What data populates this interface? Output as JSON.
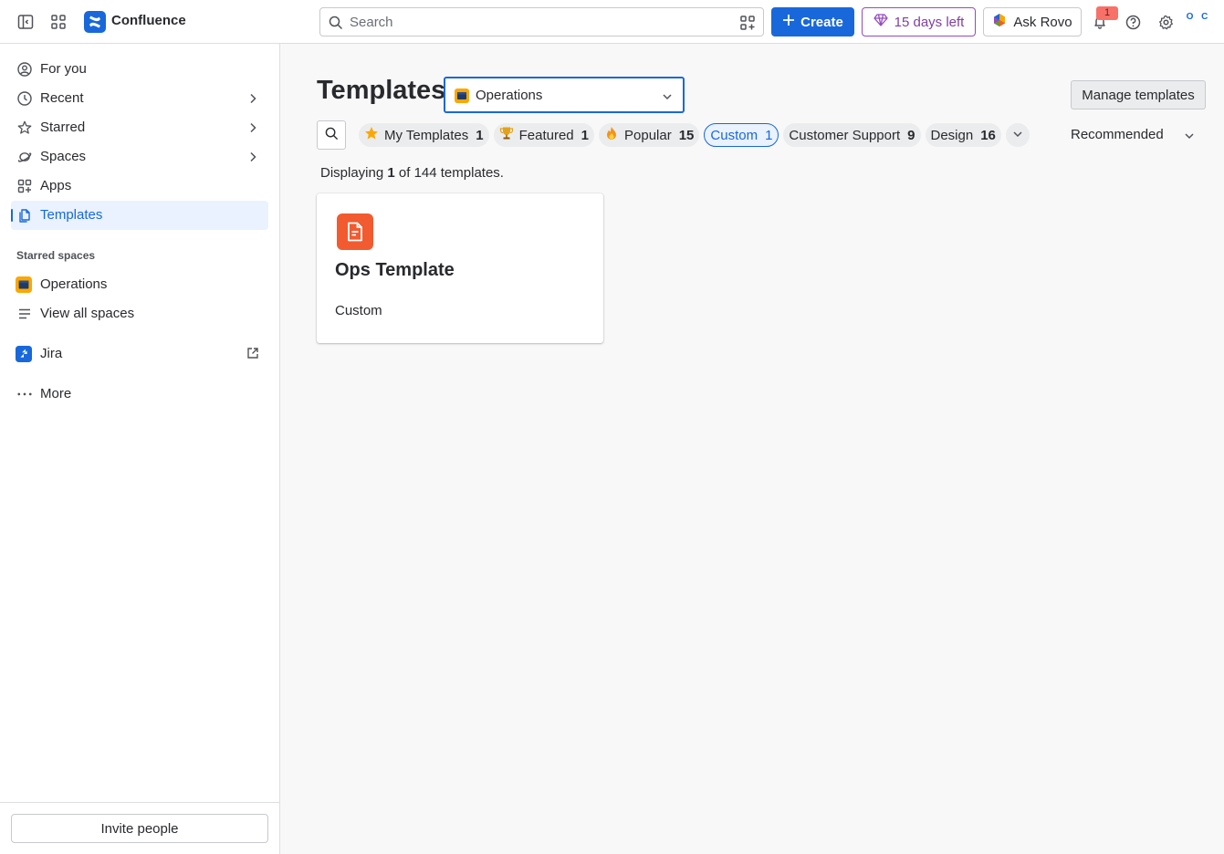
{
  "topbar": {
    "app_name": "Confluence",
    "search_placeholder": "Search",
    "create_label": "Create",
    "trial_label": "15 days left",
    "rovo_label": "Ask Rovo",
    "notification_count": "1",
    "avatar_initials": "O C",
    "icons": [
      "sidebar-toggle-icon",
      "app-switcher-icon",
      "confluence-logo-icon",
      "search-icon",
      "filter-grid-icon",
      "plus-icon",
      "gem-icon",
      "rovo-icon",
      "bell-icon",
      "help-icon",
      "settings-icon"
    ]
  },
  "sidebar": {
    "items": [
      {
        "label": "For you",
        "icon": "user-circle-icon"
      },
      {
        "label": "Recent",
        "icon": "clock-icon"
      },
      {
        "label": "Starred",
        "icon": "star-icon"
      },
      {
        "label": "Spaces",
        "icon": "spaces-icon"
      },
      {
        "label": "Apps",
        "icon": "apps-icon"
      },
      {
        "label": "Templates",
        "icon": "templates-icon",
        "active": true
      }
    ],
    "starred_spaces_heading": "Starred spaces",
    "starred_spaces": [
      {
        "label": "Operations",
        "icon": "operations-space-icon"
      },
      {
        "label": "View all spaces",
        "icon": "list-icon"
      }
    ],
    "jira_label": "Jira",
    "more_label": "More",
    "invite_label": "Invite people"
  },
  "main": {
    "title": "Templates",
    "space_selector": {
      "value": "Operations"
    },
    "manage_label": "Manage templates",
    "filters": [
      {
        "label": "My Templates",
        "count": "1",
        "icon": "star-emoji"
      },
      {
        "label": "Featured",
        "count": "1",
        "icon": "trophy-emoji"
      },
      {
        "label": "Popular",
        "count": "15",
        "icon": "fire-emoji"
      },
      {
        "label": "Custom",
        "count": "1",
        "selected": true
      },
      {
        "label": "Customer Support",
        "count": "9"
      },
      {
        "label": "Design",
        "count": "16"
      }
    ],
    "sort_label": "Recommended",
    "display": {
      "prefix": "Displaying ",
      "shown": "1",
      "suffix": " of 144 templates."
    },
    "templates": [
      {
        "title": "Ops Template",
        "category": "Custom",
        "icon": "document-icon"
      }
    ]
  },
  "colors": {
    "accent": "#1868DB",
    "trial": "#803FA5",
    "template_icon": "#F15B2F",
    "active_bg": "#E9F2FE"
  }
}
